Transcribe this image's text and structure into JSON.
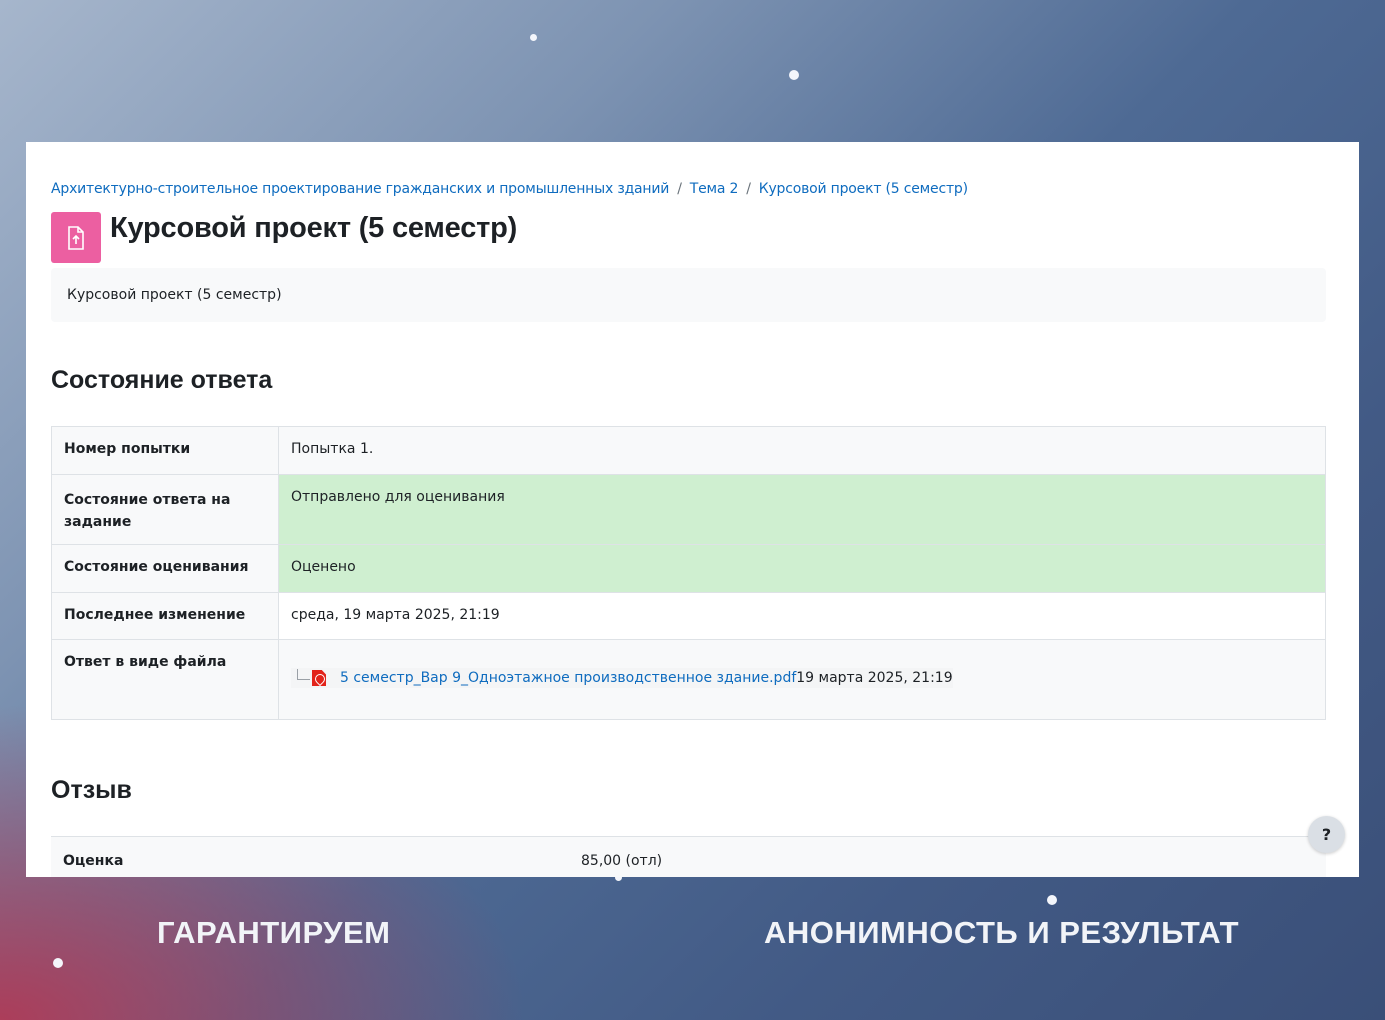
{
  "breadcrumb": {
    "course": "Архитектурно-строительное проектирование гражданских и промышленных зданий",
    "topic": "Тема 2",
    "current": "Курсовой проект (5 семестр)",
    "separator": "/"
  },
  "page": {
    "title": "Курсовой проект (5 семестр)",
    "icon": "assignment-upload-icon",
    "description": "Курсовой проект (5 семестр)"
  },
  "submission_status": {
    "heading": "Состояние ответа",
    "rows": [
      {
        "label": "Номер попытки",
        "value": "Попытка 1."
      },
      {
        "label": "Состояние ответа на задание",
        "value": "Отправлено для оценивания"
      },
      {
        "label": "Состояние оценивания",
        "value": "Оценено"
      },
      {
        "label": "Последнее изменение",
        "value": "среда, 19 марта 2025, 21:19"
      },
      {
        "label": "Ответ в виде файла",
        "file_name": "5 семестр_Вар 9_Одноэтажное производственное здание.pdf",
        "file_date": "19 марта 2025, 21:19"
      }
    ]
  },
  "feedback": {
    "heading": "Отзыв",
    "grade_label": "Оценка",
    "grade_value": "85,00 (отл)"
  },
  "help_button": "?",
  "slogan": {
    "left": "ГАРАНТИРУЕМ",
    "right": "АНОНИМНОСТЬ И РЕЗУЛЬТАТ"
  },
  "colors": {
    "link": "#0f6cbf",
    "assignment_icon_bg": "#ec5fa1",
    "status_success_bg": "#cfefd0"
  }
}
